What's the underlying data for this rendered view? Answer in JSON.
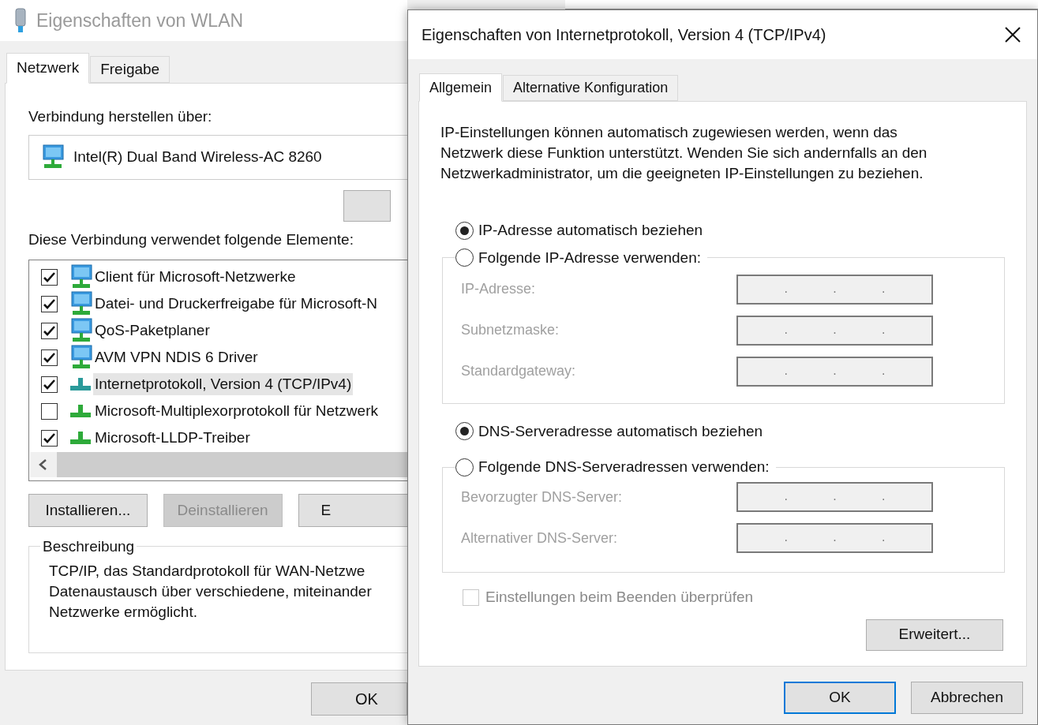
{
  "back_window": {
    "title": "Eigenschaften von WLAN",
    "tabs": [
      {
        "label": "Netzwerk",
        "selected": true
      },
      {
        "label": "Freigabe",
        "selected": false
      }
    ],
    "connect_label": "Verbindung herstellen über:",
    "adapter": "Intel(R) Dual Band Wireless-AC 8260",
    "components_label": "Diese Verbindung verwendet folgende Elemente:",
    "components": [
      {
        "label": "Client für Microsoft-Netzwerke",
        "checked": true,
        "selected": false,
        "kind": "service"
      },
      {
        "label": "Datei- und Druckerfreigabe für Microsoft-N",
        "checked": true,
        "selected": false,
        "kind": "service"
      },
      {
        "label": "QoS-Paketplaner",
        "checked": true,
        "selected": false,
        "kind": "service"
      },
      {
        "label": "AVM VPN NDIS 6 Driver",
        "checked": true,
        "selected": false,
        "kind": "service"
      },
      {
        "label": "Internetprotokoll, Version 4 (TCP/IPv4)",
        "checked": true,
        "selected": true,
        "kind": "protocol"
      },
      {
        "label": "Microsoft-Multiplexorprotokoll für Netzwerk",
        "checked": false,
        "selected": false,
        "kind": "protocol"
      },
      {
        "label": "Microsoft-LLDP-Treiber",
        "checked": true,
        "selected": false,
        "kind": "protocol"
      }
    ],
    "action_buttons": [
      {
        "label": "Installieren...",
        "disabled": false
      },
      {
        "label": "Deinstallieren",
        "disabled": true
      },
      {
        "label": "E",
        "disabled": false
      }
    ],
    "description": {
      "title": "Beschreibung",
      "lines": [
        "TCP/IP, das Standardprotokoll für WAN-Netzwe",
        "Datenaustausch über verschiedene, miteinander",
        "Netzwerke ermöglicht."
      ]
    },
    "ok_button": "OK"
  },
  "dialog": {
    "title": "Eigenschaften von Internetprotokoll, Version 4 (TCP/IPv4)",
    "tabs": [
      {
        "label": "Allgemein",
        "selected": true
      },
      {
        "label": "Alternative Konfiguration",
        "selected": false
      }
    ],
    "intro": [
      "IP-Einstellungen können automatisch zugewiesen werden, wenn das",
      "Netzwerk diese Funktion unterstützt. Wenden Sie sich andernfalls an den",
      "Netzwerkadministrator, um die geeigneten IP-Einstellungen zu beziehen."
    ],
    "ip_mode": [
      {
        "label": "IP-Adresse automatisch beziehen",
        "selected": true
      },
      {
        "label": "Folgende IP-Adresse verwenden:",
        "selected": false
      }
    ],
    "ip_fields": [
      {
        "label": "IP-Adresse:",
        "disabled": true,
        "dots": [
          ".",
          ".",
          "."
        ]
      },
      {
        "label": "Subnetzmaske:",
        "disabled": true,
        "dots": [
          ".",
          ".",
          "."
        ]
      },
      {
        "label": "Standardgateway:",
        "disabled": true,
        "dots": [
          ".",
          ".",
          "."
        ]
      }
    ],
    "dns_mode": [
      {
        "label": "DNS-Serveradresse automatisch beziehen",
        "selected": true
      },
      {
        "label": "Folgende DNS-Serveradressen verwenden:",
        "selected": false
      }
    ],
    "dns_fields": [
      {
        "label": "Bevorzugter DNS-Server:",
        "disabled": true,
        "dots": [
          ".",
          ".",
          "."
        ]
      },
      {
        "label": "Alternativer DNS-Server:",
        "disabled": true,
        "dots": [
          ".",
          ".",
          "."
        ]
      }
    ],
    "validate": {
      "label": "Einstellungen beim Beenden überprüfen",
      "checked": false,
      "disabled": true
    },
    "advanced_button": "Erweitert...",
    "buttons": [
      {
        "label": "OK",
        "default": true
      },
      {
        "label": "Abbrechen",
        "default": false
      }
    ]
  }
}
